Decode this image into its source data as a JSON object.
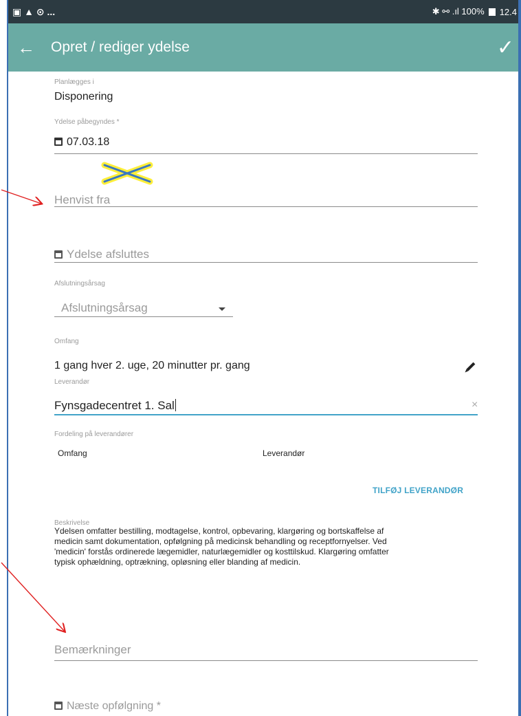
{
  "statusbar": {
    "left_icons": "▣ ▲ ⊙ ...",
    "right_text": "✱ ⚯ .ıl 100%",
    "time": "12.4"
  },
  "appbar": {
    "back_icon": "←",
    "title": "Opret / rediger ydelse",
    "confirm_icon": "✓"
  },
  "form": {
    "planned_in": {
      "label": "Planlægges i",
      "value": "Disponering"
    },
    "start": {
      "label": "Ydelse påbegyndes *",
      "value": "07.03.18"
    },
    "referred_from": {
      "placeholder": "Henvist fra"
    },
    "end": {
      "placeholder": "Ydelse afsluttes"
    },
    "end_reason": {
      "label": "Afslutningsårsag",
      "placeholder": "Afslutningsårsag"
    },
    "scope": {
      "label": "Omfang",
      "value": "1 gang hver 2. uge, 20 minutter pr. gang"
    },
    "supplier": {
      "label": "Leverandør",
      "value": "Fynsgadecentret 1. Sal",
      "clear": "×"
    },
    "distribution": {
      "label": "Fordeling på leverandører",
      "columns": [
        "Omfang",
        "Leverandør"
      ],
      "add_button": "TILFØJ LEVERANDØR"
    },
    "description": {
      "label": "Beskrivelse",
      "lines": [
        "Ydelsen omfatter bestilling, modtagelse, kontrol, opbevaring, klargøring og bortskaffelse af",
        "medicin samt dokumentation, opfølgning på medicinsk behandling og receptfornyelser. Ved",
        "'medicin' forstås ordinerede lægemidler, naturlægemidler og kosttilskud. Klargøring omfatter",
        "typisk ophældning, optrækning, opløsning eller blanding af medicin."
      ]
    },
    "remarks": {
      "placeholder": "Bemærkninger"
    },
    "next_followup": {
      "placeholder": "Næste opfølgning *"
    }
  },
  "colors": {
    "appbar": "#6aaba4",
    "statusbar": "#2c3a41",
    "accent": "#41a3c8",
    "annotation_arrow": "#e02020",
    "annotation_cross": "#3b78c0",
    "annotation_highlight": "#ffef3a"
  }
}
